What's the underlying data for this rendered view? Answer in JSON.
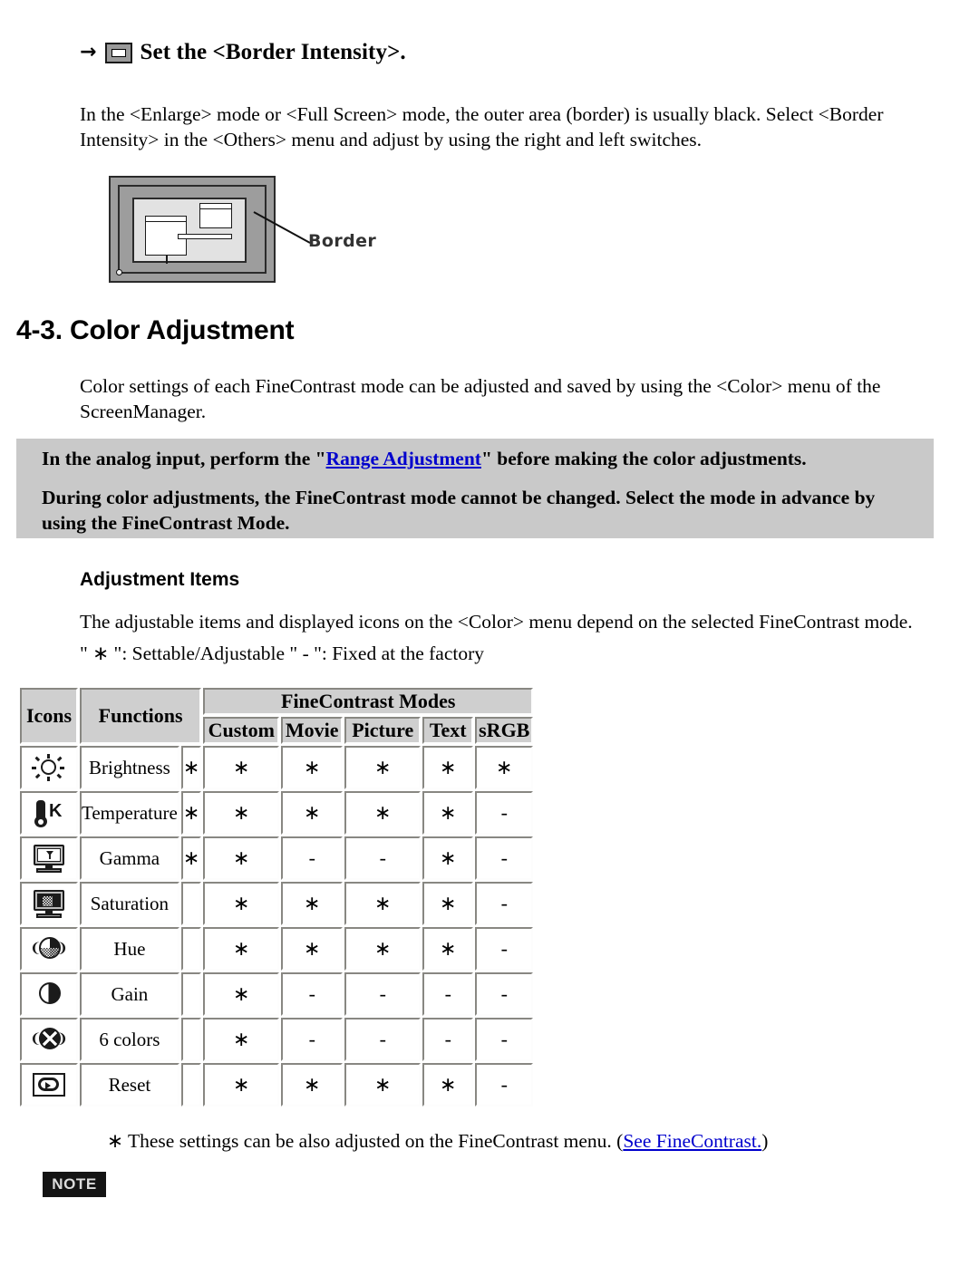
{
  "border_section": {
    "arrow": "→",
    "heading": "Set the <Border Intensity>.",
    "intro": "In the <Enlarge> mode or <Full Screen> mode, the outer area (border) is usually black. Select <Border Intensity> in the <Others> menu and adjust by using the right and left switches.",
    "diagram_label": "Border"
  },
  "section": {
    "title": "4-3. Color Adjustment",
    "intro": "Color settings of each FineContrast mode can be adjusted and saved by using the <Color> menu of the ScreenManager."
  },
  "notice": {
    "line1_before": "In the analog input, perform the \"",
    "line1_link": "Range Adjustment",
    "line1_after": "\" before making the color adjustments.",
    "line2": "During color adjustments, the FineContrast mode cannot be changed. Select the mode in advance by using the FineContrast Mode."
  },
  "adjustment": {
    "heading": "Adjustment Items",
    "description": "The adjustable items and displayed icons on the <Color> menu depend on the selected FineContrast mode.",
    "legend": "\" ∗ \": Settable/Adjustable \" - \": Fixed at the factory"
  },
  "table": {
    "header": {
      "icons": "Icons",
      "functions": "Functions",
      "modes_group": "FineContrast Modes",
      "modes": [
        "Custom",
        "Movie",
        "Picture",
        "Text",
        "sRGB"
      ]
    },
    "rows": [
      {
        "icon": "brightness-icon",
        "function": "Brightness",
        "extra": "∗",
        "values": [
          "∗",
          "∗",
          "∗",
          "∗",
          "∗"
        ]
      },
      {
        "icon": "temperature-icon",
        "function": "Temperature",
        "extra": "∗",
        "values": [
          "∗",
          "∗",
          "∗",
          "∗",
          "-"
        ]
      },
      {
        "icon": "gamma-icon",
        "function": "Gamma",
        "extra": "∗",
        "values": [
          "∗",
          "-",
          "-",
          "∗",
          "-"
        ]
      },
      {
        "icon": "saturation-icon",
        "function": "Saturation",
        "extra": "",
        "values": [
          "∗",
          "∗",
          "∗",
          "∗",
          "-"
        ]
      },
      {
        "icon": "hue-icon",
        "function": "Hue",
        "extra": "",
        "values": [
          "∗",
          "∗",
          "∗",
          "∗",
          "-"
        ]
      },
      {
        "icon": "gain-icon",
        "function": "Gain",
        "extra": "",
        "values": [
          "∗",
          "-",
          "-",
          "-",
          "-"
        ]
      },
      {
        "icon": "six-colors-icon",
        "function": "6 colors",
        "extra": "",
        "values": [
          "∗",
          "-",
          "-",
          "-",
          "-"
        ]
      },
      {
        "icon": "reset-icon",
        "function": "Reset",
        "extra": "",
        "values": [
          "∗",
          "∗",
          "∗",
          "∗",
          "-"
        ]
      }
    ]
  },
  "footnote": {
    "before": "∗ These settings can be also adjusted on the FineContrast menu. (",
    "link": "See FineContrast.",
    "after": ")"
  },
  "note_badge": {
    "label": "NOTE"
  },
  "colors": {
    "notice_background": "#c9c9c9",
    "table_header_background": "#cfcfcf",
    "link": "#0000cd",
    "note_badge_background": "#141414",
    "note_badge_text": "#dcdcdc"
  }
}
